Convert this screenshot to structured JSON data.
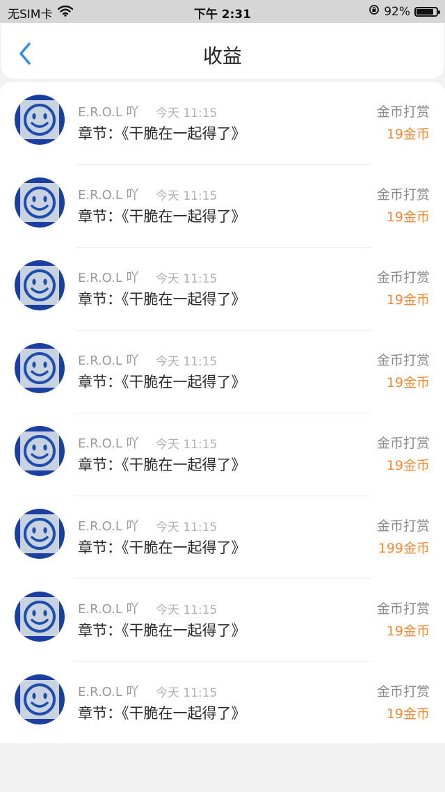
{
  "status_bar": {
    "carrier": "无SIM卡",
    "time": "下午 2:31",
    "battery_text": "92%",
    "battery_level": 0.92,
    "icons": [
      "wifi-icon",
      "orientation-lock-icon",
      "battery-icon"
    ]
  },
  "nav": {
    "title": "收益",
    "back_icon": "chevron-left-icon"
  },
  "colors": {
    "accent": "#2f8ee8",
    "amount": "#ef8a3a",
    "avatar_bg": "#1b3fa1"
  },
  "records": [
    {
      "user": "E.R.O.L 吖",
      "time": "今天 11:15",
      "chapter": "章节：《干脆在一起得了》",
      "type": "金币打赏",
      "amount": "19金币"
    },
    {
      "user": "E.R.O.L 吖",
      "time": "今天 11:15",
      "chapter": "章节：《干脆在一起得了》",
      "type": "金币打赏",
      "amount": "19金币"
    },
    {
      "user": "E.R.O.L 吖",
      "time": "今天 11:15",
      "chapter": "章节：《干脆在一起得了》",
      "type": "金币打赏",
      "amount": "19金币"
    },
    {
      "user": "E.R.O.L 吖",
      "time": "今天 11:15",
      "chapter": "章节：《干脆在一起得了》",
      "type": "金币打赏",
      "amount": "19金币"
    },
    {
      "user": "E.R.O.L 吖",
      "time": "今天 11:15",
      "chapter": "章节：《干脆在一起得了》",
      "type": "金币打赏",
      "amount": "19金币"
    },
    {
      "user": "E.R.O.L 吖",
      "time": "今天 11:15",
      "chapter": "章节：《干脆在一起得了》",
      "type": "金币打赏",
      "amount": "199金币"
    },
    {
      "user": "E.R.O.L 吖",
      "time": "今天 11:15",
      "chapter": "章节：《干脆在一起得了》",
      "type": "金币打赏",
      "amount": "19金币"
    },
    {
      "user": "E.R.O.L 吖",
      "time": "今天 11:15",
      "chapter": "章节：《干脆在一起得了》",
      "type": "金币打赏",
      "amount": "19金币"
    }
  ]
}
